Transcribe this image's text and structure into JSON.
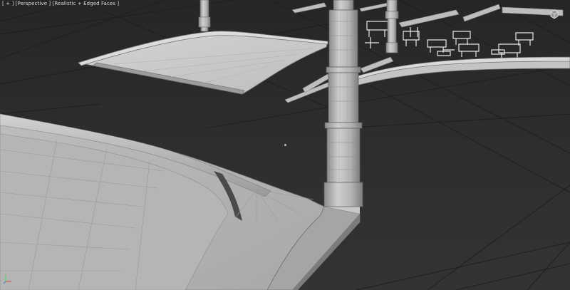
{
  "viewport": {
    "menu_plus": "[ + ]",
    "menu_view": "[Perspective ]",
    "menu_shading": "[Realistic + Edged Faces ]"
  },
  "colors": {
    "background": "#2b2b2b",
    "grid_line": "#1e1e1e",
    "model_light": "#c9c9c9",
    "model_mid": "#a9a9a9",
    "model_dark": "#6f6f6f",
    "label_text": "#d8d8d8"
  },
  "icons": {
    "viewcube": "viewcube-icon",
    "axis": "axis-tripod-icon"
  }
}
